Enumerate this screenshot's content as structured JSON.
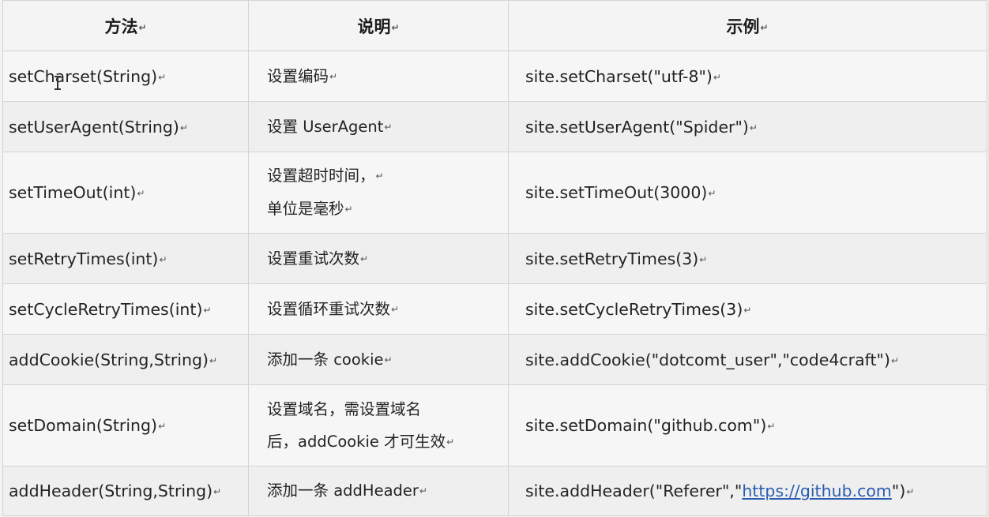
{
  "table": {
    "headers": {
      "method": "方法",
      "description": "说明",
      "example": "示例"
    },
    "mark": "↵",
    "rows": [
      {
        "method": "setCharset(String)",
        "desc_lines": [
          "设置编码"
        ],
        "example": "site.setCharset(\"utf-8\")"
      },
      {
        "method": "setUserAgent(String)",
        "desc_lines": [
          "设置 UserAgent"
        ],
        "example": "site.setUserAgent(\"Spider\")"
      },
      {
        "method": "setTimeOut(int)",
        "desc_lines": [
          "设置超时时间，",
          "单位是毫秒"
        ],
        "example": "site.setTimeOut(3000)"
      },
      {
        "method": "setRetryTimes(int)",
        "desc_lines": [
          "设置重试次数"
        ],
        "example": "site.setRetryTimes(3)"
      },
      {
        "method": "setCycleRetryTimes(int)",
        "desc_lines": [
          "设置循环重试次数"
        ],
        "example": "site.setCycleRetryTimes(3)"
      },
      {
        "method": "addCookie(String,String)",
        "desc_lines": [
          "添加一条 cookie"
        ],
        "example": "site.addCookie(\"dotcomt_user\",\"code4craft\")"
      },
      {
        "method": "setDomain(String)",
        "desc_lines": [
          "设置域名，需设置域名",
          "后，addCookie 才可生效"
        ],
        "example": "site.setDomain(\"github.com\")"
      },
      {
        "method": "addHeader(String,String)",
        "desc_lines": [
          "添加一条 addHeader"
        ],
        "example_prefix": "site.addHeader(\"Referer\",\"",
        "example_link": "https://github.com",
        "example_suffix": "\")"
      }
    ]
  }
}
